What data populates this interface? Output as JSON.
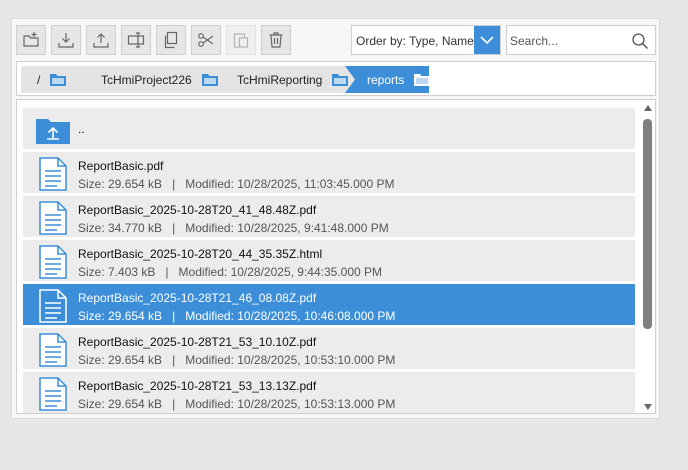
{
  "toolbar": {
    "buttons": [
      {
        "name": "new-folder-icon",
        "disabled": false
      },
      {
        "name": "download-icon",
        "disabled": false
      },
      {
        "name": "upload-icon",
        "disabled": false
      },
      {
        "name": "rename-icon",
        "disabled": false
      },
      {
        "name": "copy-icon",
        "disabled": false
      },
      {
        "name": "cut-icon",
        "disabled": false
      },
      {
        "name": "paste-icon",
        "disabled": true
      },
      {
        "name": "delete-icon",
        "disabled": false
      }
    ]
  },
  "order_by": {
    "label": "Order by: Type, Name"
  },
  "search": {
    "placeholder": "Search..."
  },
  "breadcrumb": {
    "items": [
      {
        "label": "/",
        "active": false
      },
      {
        "label": "TcHmiProject226",
        "active": false
      },
      {
        "label": "TcHmiReporting",
        "active": false
      },
      {
        "label": "reports",
        "active": true
      }
    ]
  },
  "file_list": {
    "parent": {
      "label": ".."
    },
    "items": [
      {
        "name": "ReportBasic.pdf",
        "size": "Size: 29.654 kB",
        "modified": "Modified: 10/28/2025, 11:03:45.000 PM",
        "selected": false
      },
      {
        "name": "ReportBasic_2025-10-28T20_41_48.48Z.pdf",
        "size": "Size: 34.770 kB",
        "modified": "Modified: 10/28/2025, 9:41:48.000 PM",
        "selected": false
      },
      {
        "name": "ReportBasic_2025-10-28T20_44_35.35Z.html",
        "size": "Size: 7.403 kB",
        "modified": "Modified: 10/28/2025, 9:44:35.000 PM",
        "selected": false
      },
      {
        "name": "ReportBasic_2025-10-28T21_46_08.08Z.pdf",
        "size": "Size: 29.654 kB",
        "modified": "Modified: 10/28/2025, 10:46:08.000 PM",
        "selected": true
      },
      {
        "name": "ReportBasic_2025-10-28T21_53_10.10Z.pdf",
        "size": "Size: 29.654 kB",
        "modified": "Modified: 10/28/2025, 10:53:10.000 PM",
        "selected": false
      },
      {
        "name": "ReportBasic_2025-10-28T21_53_13.13Z.pdf",
        "size": "Size: 29.654 kB",
        "modified": "Modified: 10/28/2025, 10:53:13.000 PM",
        "selected": false
      }
    ],
    "meta_separator": "|"
  },
  "colors": {
    "accent": "#3b8ed7",
    "row_bg": "#ececec",
    "crumb_bg": "#e4e4e4"
  }
}
